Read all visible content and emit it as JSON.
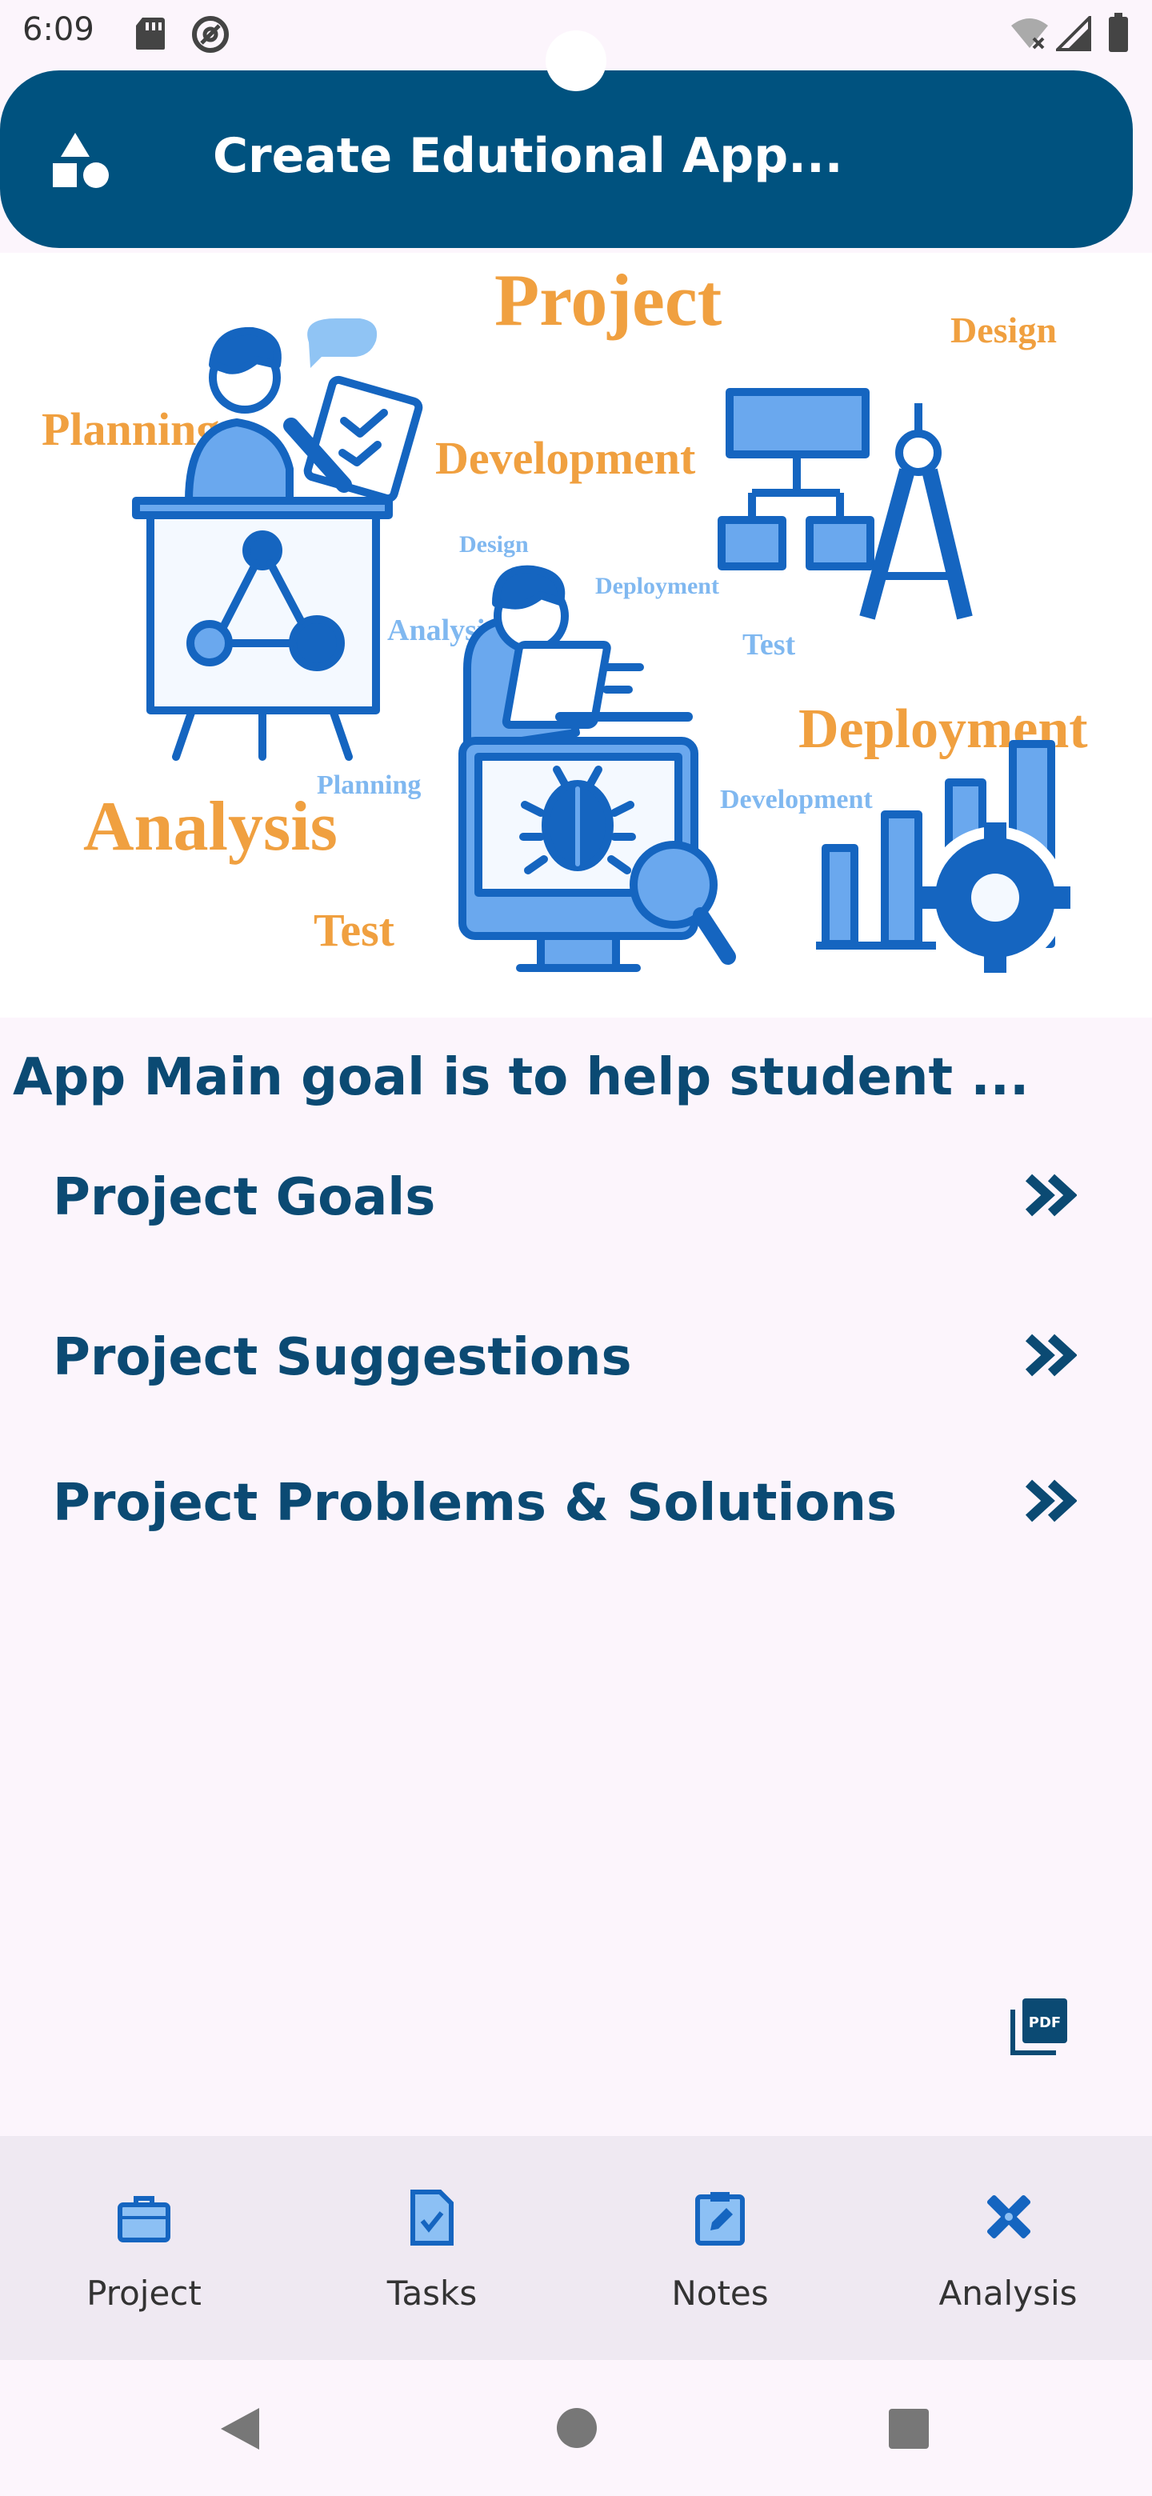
{
  "status_bar": {
    "time": "6:09"
  },
  "app_bar": {
    "title": "Create Edutional App..."
  },
  "illustration": {
    "words": {
      "project": "Project",
      "design": "Design",
      "planning": "Planning",
      "development": "Development",
      "design_small": "Design",
      "deployment_small": "Deployment",
      "analysis_small": "Analysis",
      "test_small": "Test",
      "deployment": "Deployment",
      "analysis": "Analysis",
      "planning_small": "Planning",
      "development_small": "Development",
      "test": "Test"
    }
  },
  "main": {
    "subtitle": "App Main goal is to help student ...",
    "menu": [
      {
        "label": "Project Goals"
      },
      {
        "label": "Project Suggestions"
      },
      {
        "label": "Project Problems & Solutions"
      }
    ]
  },
  "bottom_nav": {
    "items": [
      {
        "label": "Project",
        "icon": "briefcase-icon"
      },
      {
        "label": "Tasks",
        "icon": "task-document-icon"
      },
      {
        "label": "Notes",
        "icon": "note-clipboard-icon"
      },
      {
        "label": "Analysis",
        "icon": "design-tools-icon"
      }
    ]
  },
  "colors": {
    "primary": "#00527f",
    "text_primary": "#0b4a73",
    "background": "#fcf5fc",
    "nav_background": "#efe9f2",
    "icon_blue": "#1565c0",
    "orange": "#f0a040",
    "light_blue": "#80b8f0"
  }
}
